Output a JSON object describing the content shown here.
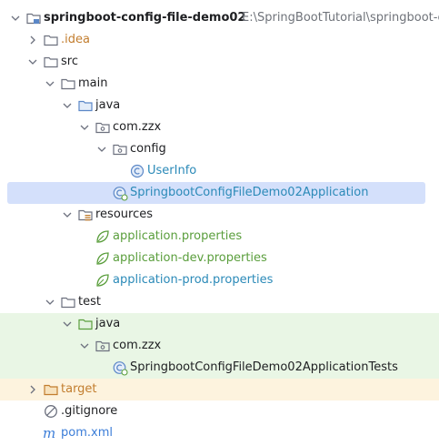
{
  "project": {
    "name": "springboot-config-file-demo02",
    "path": "E:\\SpringBootTutorial\\springboot-c"
  },
  "items": {
    "idea": ".idea",
    "src": "src",
    "main": "main",
    "main_java": "java",
    "main_pkg": "com.zzx",
    "config": "config",
    "userinfo": "UserInfo",
    "app_class": "SpringbootConfigFileDemo02Application",
    "resources": "resources",
    "app_props": "application.properties",
    "app_dev_props": "application-dev.properties",
    "app_prod_props": "application-prod.properties",
    "test": "test",
    "test_java": "java",
    "test_pkg": "com.zzx",
    "test_class": "SpringbootConfigFileDemo02ApplicationTests",
    "target": "target",
    "gitignore": ".gitignore",
    "pom": "pom.xml"
  },
  "colors": {
    "selection": "#d4e0fb",
    "test_band": "#e9f6e5",
    "target_band": "#fdf3de",
    "excluded_text": "#c27d2e",
    "class_text": "#2b8ab8",
    "resource_text": "#5a9e3c",
    "folder_blue": "#5b87c7"
  },
  "icons": {
    "expanded_chevron": "chevron-down-icon",
    "collapsed_chevron": "chevron-right-icon",
    "module": "module-folder-icon",
    "folder": "folder-icon",
    "source_root": "source-folder-icon",
    "package": "package-icon",
    "class": "class-icon",
    "spring_boot_class": "spring-boot-class-icon",
    "resources_root": "resources-folder-icon",
    "spring_properties": "spring-properties-icon",
    "ignore": "gitignore-icon",
    "maven": "maven-icon"
  }
}
